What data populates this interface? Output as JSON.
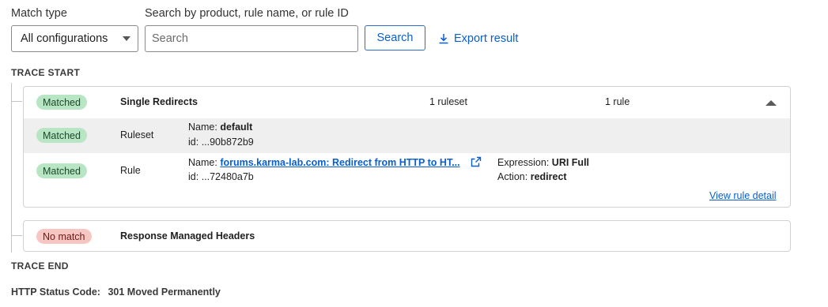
{
  "filters": {
    "match_type_label": "Match type",
    "match_type_value": "All configurations",
    "search_label": "Search by product, rule name, or rule ID",
    "search_placeholder": "Search",
    "search_button": "Search",
    "export_label": "Export result"
  },
  "trace": {
    "start_label": "TRACE START",
    "end_label": "TRACE END",
    "phases": [
      {
        "status": "Matched",
        "name": "Single Redirects",
        "ruleset_count": "1 ruleset",
        "rule_count": "1 rule",
        "expanded": true,
        "rows": [
          {
            "status": "Matched",
            "type": "Ruleset",
            "name_label": "Name:",
            "name_value": "default",
            "id_label": "id:",
            "id_value": "...90b872b9"
          },
          {
            "status": "Matched",
            "type": "Rule",
            "name_label": "Name:",
            "name_value": "forums.karma-lab.com: Redirect from HTTP to HT...",
            "id_label": "id:",
            "id_value": "...72480a7b",
            "expression_label": "Expression:",
            "expression_value": "URI Full",
            "action_label": "Action:",
            "action_value": "redirect",
            "detail_link": "View rule detail"
          }
        ]
      },
      {
        "status": "No match",
        "name": "Response Managed Headers",
        "expanded": false
      }
    ]
  },
  "result": {
    "status_label": "HTTP Status Code:",
    "status_value": "301 Moved Permanently"
  },
  "colors": {
    "accent": "#0a5fcf",
    "matched_bg": "#b8e6c4",
    "nomatch_bg": "#f6c6c2"
  },
  "icons": [
    "caret-down-icon",
    "download-icon",
    "chevron-up-icon",
    "external-link-icon"
  ]
}
